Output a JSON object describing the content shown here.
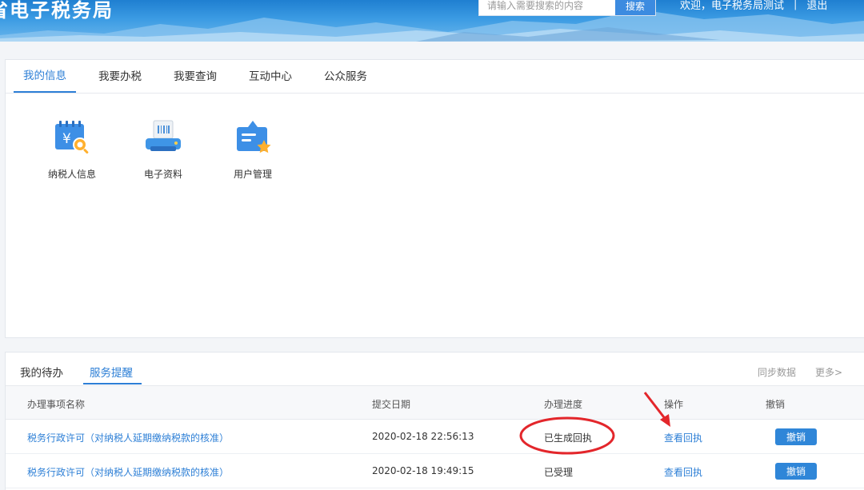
{
  "header": {
    "title": "省电子税务局",
    "search_placeholder": "请输入需要搜索的内容",
    "search_button": "搜索",
    "welcome": "欢迎，电子税务局测试",
    "separator": "|",
    "logout": "退出"
  },
  "main_tabs": [
    "我的信息",
    "我要办税",
    "我要查询",
    "互动中心",
    "公众服务"
  ],
  "apps": [
    {
      "label": "纳税人信息",
      "icon": "taxpayer-info-icon"
    },
    {
      "label": "电子资料",
      "icon": "scanner-icon"
    },
    {
      "label": "用户管理",
      "icon": "user-management-icon"
    }
  ],
  "notice": {
    "tabs": [
      "我的待办",
      "服务提醒"
    ],
    "sync": "同步数据",
    "more": "更多>",
    "columns": [
      "办理事项名称",
      "提交日期",
      "办理进度",
      "操作",
      "撤销"
    ],
    "rows": [
      {
        "name": "税务行政许可（对纳税人延期缴纳税款的核准）",
        "date": "2020-02-18 22:56:13",
        "status": "已生成回执",
        "action": "查看回执",
        "revoke": "撤销"
      },
      {
        "name": "税务行政许可（对纳税人延期缴纳税款的核准）",
        "date": "2020-02-18 19:49:15",
        "status": "已受理",
        "action": "查看回执",
        "revoke": "撤销"
      }
    ]
  },
  "colors": {
    "accent": "#2d7fd6",
    "header_blue": "#3b9be3",
    "annotation_red": "#e3262b"
  }
}
